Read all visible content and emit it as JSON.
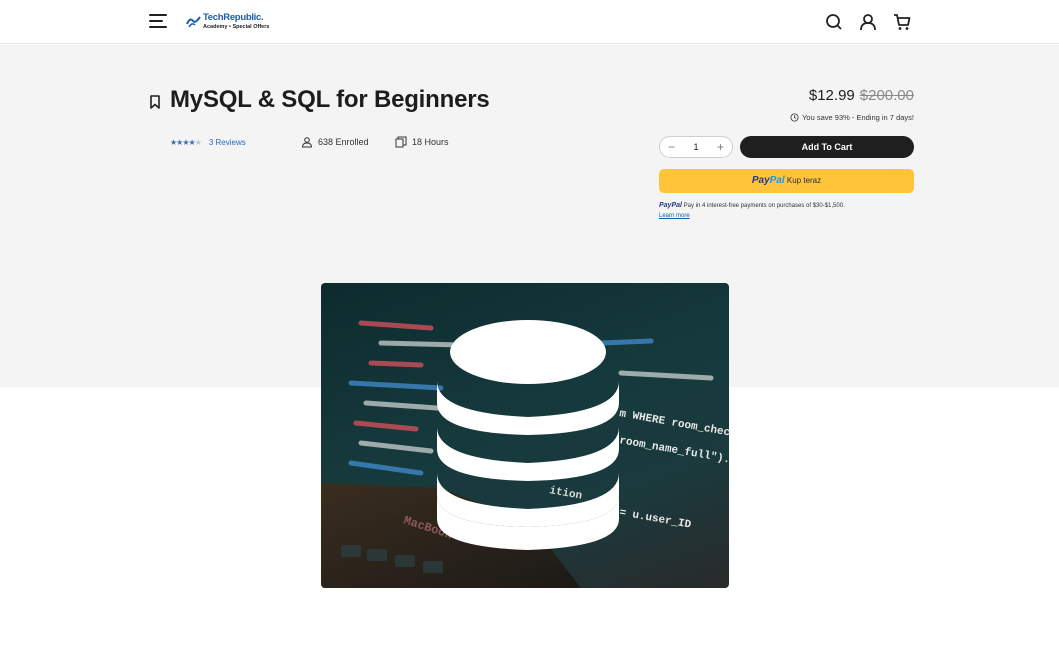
{
  "header": {
    "logo_brand": "TechRepublic.",
    "logo_sub": "Academy • Special Offers",
    "icons": [
      "menu-icon",
      "search-icon",
      "user-icon",
      "cart-icon"
    ]
  },
  "product": {
    "title": "MySQL & SQL for Beginners",
    "rating": 4.5,
    "reviews": "3 Reviews",
    "enrolled": "638 Enrolled",
    "hours": "18 Hours"
  },
  "pricing": {
    "price": "$12.99",
    "original_price": "$200.00",
    "savings": "You save 93% - Ending in 7 days!",
    "quantity": "1",
    "add_to_cart": "Add To Cart"
  },
  "paypal": {
    "logo_pay": "Pay",
    "logo_pal": "Pal",
    "button_text": "Kup teraz",
    "info_brand": "PayPal",
    "info_text": "Pay in 4 interest-free payments on purchases of $30-$1,500.",
    "learn_more": "Learn more"
  },
  "hero_image": {
    "code_lines": [
      "m WHERE room_checked",
      "room_name_full\").\"",
      "= u.user_ID",
      "ition",
      "MacBook"
    ]
  },
  "colors": {
    "brand": "#1b5fa8",
    "cart_button": "#1f1f1f",
    "paypal_yellow": "#ffc439",
    "hero_bg": "#f4f4f4"
  }
}
